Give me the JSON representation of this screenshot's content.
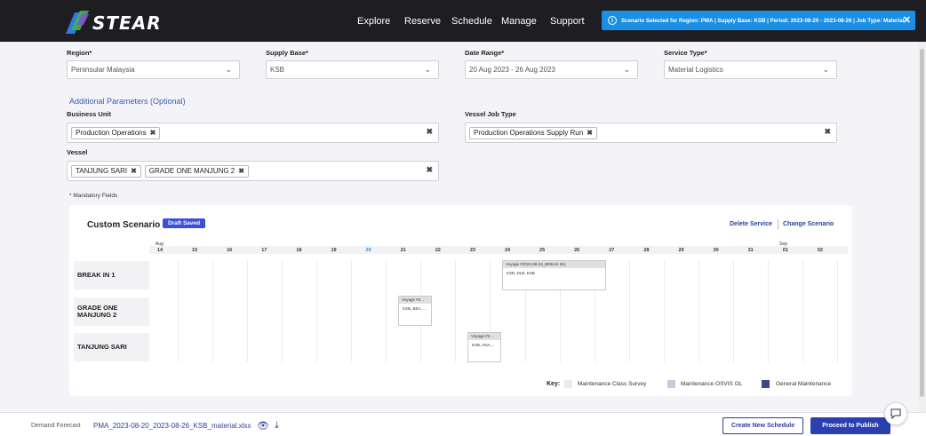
{
  "brand": {
    "name": "STEAR"
  },
  "nav": {
    "items": [
      "Explore",
      "Reserve",
      "Schedule",
      "Manage",
      "Support"
    ]
  },
  "alert": {
    "text": "Scenario Selected for Region: PMA | Supply Base: KSB | Period: 2023-08-20 - 2023-08-26 | Job Type: Material"
  },
  "form": {
    "region": {
      "label": "Region*",
      "value": "Peninsular Malaysia"
    },
    "supply_base": {
      "label": "Supply Base*",
      "value": "KSB"
    },
    "date_range": {
      "label": "Date Range*",
      "value": "20 Aug 2023 - 26 Aug 2023"
    },
    "service_type": {
      "label": "Service Type*",
      "value": "Material Logistics"
    },
    "additional_title": "Additional Parameters (Optional)",
    "business_unit": {
      "label": "Business Unit",
      "tags": [
        "Production Operations"
      ]
    },
    "vessel_job_type": {
      "label": "Vessel Job Type",
      "tags": [
        "Production Operations Supply Run"
      ]
    },
    "vessel": {
      "label": "Vessel",
      "tags": [
        "TANJUNG SARI",
        "GRADE ONE MANJUNG 2"
      ]
    },
    "mandatory_note": "* Mandatory Fields"
  },
  "scenario": {
    "title": "Custom Scenario",
    "badge": "Draft Saved",
    "delete_label": "Delete Service",
    "change_label": "Change Scenario",
    "months": [
      "Aug",
      "Sep"
    ],
    "days": [
      "14",
      "15",
      "16",
      "17",
      "18",
      "19",
      "20",
      "21",
      "22",
      "23",
      "24",
      "25",
      "26",
      "27",
      "28",
      "29",
      "30",
      "31",
      "01",
      "02"
    ],
    "today": "20",
    "rows": [
      "BREAK IN 1",
      "GRADE ONE MANJUNG 2",
      "TANJUNG SARI"
    ],
    "voyages": [
      {
        "title": "Voyage #2023-08-24_BREAK IN1",
        "detail": "KSB, DLB, KSB"
      },
      {
        "title": "Voyage #2...",
        "detail": "KSB, BEA, ..."
      },
      {
        "title": "Voyage #2...",
        "detail": "KSB, ANA,..."
      }
    ],
    "key": {
      "label": "Key:",
      "items": [
        {
          "name": "Maintenance Class Survey",
          "color": "#ececef"
        },
        {
          "name": "Maintenance OSVIS GL",
          "color": "#c7cbe0"
        },
        {
          "name": "General Maintenance",
          "color": "#3b4a8c"
        }
      ]
    }
  },
  "footer": {
    "label": "Demand Forecast",
    "file": "PMA_2023-08-20_2023-08-26_KSB_material.xlsx",
    "create_label": "Create New Schedule",
    "publish_label": "Proceed to Publish"
  },
  "colors": {
    "topbar": "#1d1d22",
    "accent": "#2a3fb0",
    "alert": "#1b8fe3",
    "badge": "#3b4fd8"
  }
}
